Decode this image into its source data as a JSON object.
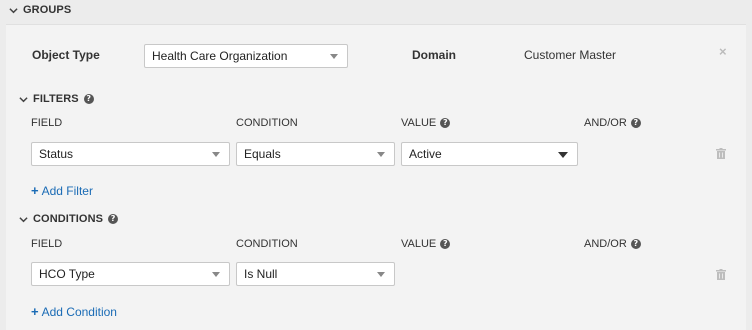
{
  "groups_header": "GROUPS",
  "object_type": {
    "label": "Object Type",
    "value": "Health Care Organization"
  },
  "domain": {
    "label": "Domain",
    "value": "Customer Master"
  },
  "close_glyph": "×",
  "filters": {
    "header": "FILTERS",
    "columns": {
      "field": "FIELD",
      "condition": "CONDITION",
      "value": "VALUE",
      "and_or": "AND/OR"
    },
    "row": {
      "field": "Status",
      "condition": "Equals",
      "value": "Active"
    },
    "add_label": "Add Filter"
  },
  "conditions": {
    "header": "CONDITIONS",
    "columns": {
      "field": "FIELD",
      "condition": "CONDITION",
      "value": "VALUE",
      "and_or": "AND/OR"
    },
    "row": {
      "field": "HCO Type",
      "condition": "Is Null"
    },
    "add_label": "Add Condition"
  },
  "help_glyph": "?",
  "colors": {
    "link": "#1a6bb5",
    "panel": "#f3f3f3",
    "background": "#ececec"
  },
  "icons": [
    "chevron-down-icon",
    "help-icon",
    "caret-down-icon",
    "trash-icon",
    "close-icon",
    "plus-icon"
  ]
}
